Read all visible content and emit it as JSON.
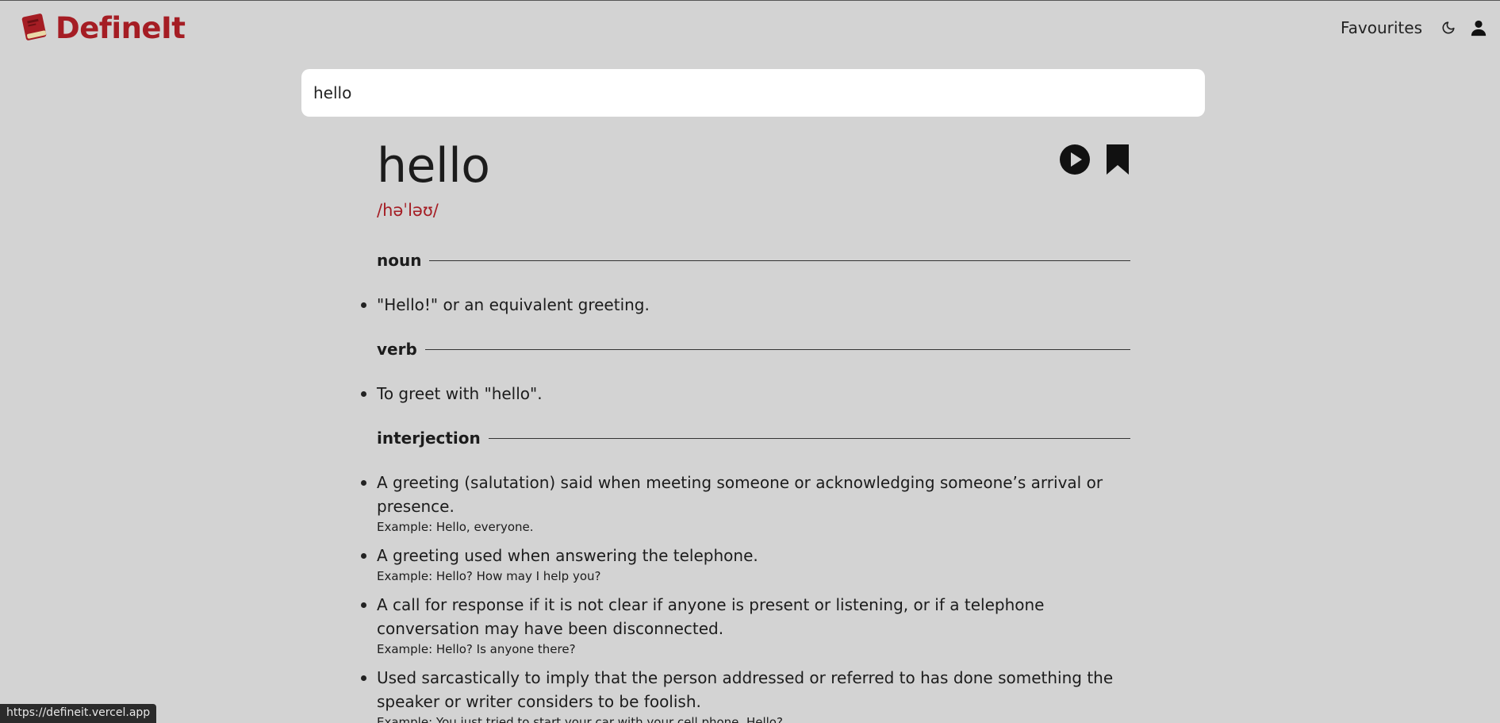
{
  "app": {
    "name": "DefineIt"
  },
  "nav": {
    "favourites": "Favourites",
    "theme_icon": "moon-icon",
    "account_icon": "user-icon"
  },
  "search": {
    "value": "hello",
    "placeholder": ""
  },
  "entry": {
    "word": "hello",
    "phonetic": "/həˈləʊ/",
    "play_icon": "play-icon",
    "bookmark_icon": "bookmark-icon",
    "meanings": [
      {
        "part_of_speech": "noun",
        "definitions": [
          {
            "text": "\"Hello!\" or an equivalent greeting.",
            "example": ""
          }
        ]
      },
      {
        "part_of_speech": "verb",
        "definitions": [
          {
            "text": "To greet with \"hello\".",
            "example": ""
          }
        ]
      },
      {
        "part_of_speech": "interjection",
        "definitions": [
          {
            "text": "A greeting (salutation) said when meeting someone or acknowledging someone’s arrival or presence.",
            "example": "Example: Hello, everyone."
          },
          {
            "text": "A greeting used when answering the telephone.",
            "example": "Example: Hello? How may I help you?"
          },
          {
            "text": "A call for response if it is not clear if anyone is present or listening, or if a telephone conversation may have been disconnected.",
            "example": "Example: Hello? Is anyone there?"
          },
          {
            "text": "Used sarcastically to imply that the person addressed or referred to has done something the speaker or writer considers to be foolish.",
            "example": "Example: You just tried to start your car with your cell phone. Hello?"
          }
        ]
      }
    ]
  },
  "status_bar": {
    "url": "https://defineit.vercel.app"
  },
  "colors": {
    "background": "#d3d3d3",
    "brand": "#a51d24",
    "text": "#1c1c1c"
  }
}
